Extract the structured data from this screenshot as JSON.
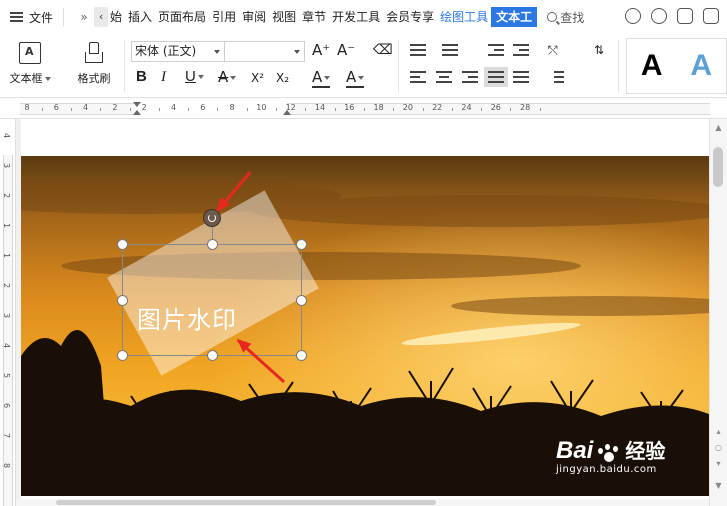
{
  "tabbar": {
    "file_label": "文件",
    "more_glyph": "»",
    "back_glyph": "‹",
    "tabs": [
      {
        "label": "始",
        "state": "partial"
      },
      {
        "label": "插入",
        "state": "normal"
      },
      {
        "label": "页面布局",
        "state": "normal"
      },
      {
        "label": "引用",
        "state": "normal"
      },
      {
        "label": "审阅",
        "state": "normal"
      },
      {
        "label": "视图",
        "state": "normal"
      },
      {
        "label": "章节",
        "state": "normal"
      },
      {
        "label": "开发工具",
        "state": "normal"
      },
      {
        "label": "会员专享",
        "state": "normal"
      },
      {
        "label": "绘图工具",
        "state": "drawing"
      },
      {
        "label": "文本工",
        "state": "active"
      }
    ],
    "search_label": "查找"
  },
  "ribbon": {
    "textbox_label": "文本框",
    "format_painter_label": "格式刷",
    "font_name": "宋体 (正文)",
    "font_size": "",
    "grow_font": "A⁺",
    "shrink_font": "A⁻",
    "bold": "B",
    "italic": "I",
    "underline": "U",
    "strike": "A",
    "superscript": "X²",
    "subscript": "X₂",
    "highlight": "A",
    "font_color": "A",
    "style_black": "A",
    "style_blue": "A"
  },
  "ruler": {
    "h_ticks": [
      "8",
      "6",
      "4",
      "2",
      "2",
      "4",
      "6",
      "8",
      "10",
      "12",
      "14",
      "16",
      "18",
      "20",
      "22",
      "24",
      "26",
      "28"
    ],
    "v_ticks": [
      "4",
      "3",
      "2",
      "1",
      "1",
      "2",
      "3",
      "4",
      "5",
      "6",
      "7",
      "8"
    ]
  },
  "document": {
    "watermark_text": "图片水印"
  },
  "site_watermark": {
    "brand_left": "Bai",
    "brand_right": "经验",
    "url": "jingyan.baidu.com"
  },
  "colors": {
    "accent": "#2b78e4",
    "arrow": "#e8281f"
  }
}
